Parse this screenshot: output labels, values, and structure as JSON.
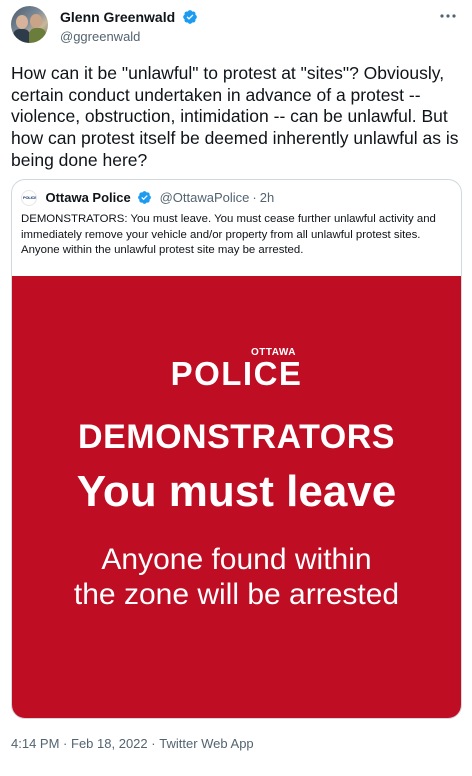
{
  "author": {
    "display_name": "Glenn Greenwald",
    "handle": "@ggreenwald",
    "verified": true
  },
  "tweet": {
    "text": "How can it be \"unlawful\" to protest at \"sites\"? Obviously, certain conduct undertaken in advance of a protest -- violence, obstruction, intimidation -- can be unlawful. But how can protest itself be deemed inherently unlawful as is being done here?"
  },
  "quoted_tweet": {
    "display_name": "Ottawa Police",
    "handle": "@OttawaPolice",
    "separator": "·",
    "time": "2h",
    "verified": true,
    "text": "DEMONSTRATORS: You must leave. You must cease further unlawful activity and immediately remove your vehicle and/or property from all unlawful protest sites. Anyone within the unlawful protest site may be arrested.",
    "image": {
      "logo_small": "OTTAWA",
      "logo_large": "POLICE",
      "heading": "DEMONSTRATORS",
      "subheading": "You must leave",
      "line1": "Anyone found within",
      "line2": "the zone will be arrested",
      "background_color": "#bf0d24"
    }
  },
  "meta": {
    "time": "4:14 PM",
    "separator1": "·",
    "date": "Feb 18, 2022",
    "separator2": "·",
    "source": "Twitter Web App"
  },
  "colors": {
    "verified": "#1d9bf0",
    "secondary_text": "#536471",
    "border": "#cfd9de"
  },
  "icons": {
    "more": "more-icon",
    "verified": "verified-badge-icon"
  }
}
